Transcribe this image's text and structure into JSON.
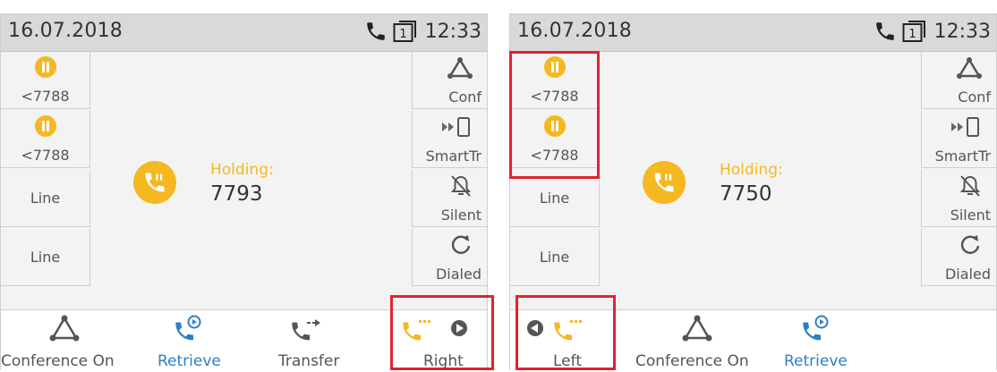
{
  "colors": {
    "accent": "#f5b820",
    "blue": "#2f7fc4",
    "highlight": "#e3222b"
  },
  "left_screen": {
    "date": "16.07.2018",
    "time": "12:33",
    "status_icons": [
      "phone-icon",
      "line-1-icon"
    ],
    "line_badge": "1",
    "line_keys": [
      {
        "label": "<7788",
        "icon": "hold-icon"
      },
      {
        "label": "<7788",
        "icon": "hold-icon"
      },
      {
        "label": "Line"
      },
      {
        "label": "Line"
      }
    ],
    "softkeys": [
      {
        "label": "Conf",
        "icon": "conference-icon"
      },
      {
        "label": "SmartTr",
        "icon": "smart-transfer-icon"
      },
      {
        "label": "Silent",
        "icon": "silent-icon"
      },
      {
        "label": "Dialed",
        "icon": "redial-icon"
      }
    ],
    "call": {
      "status": "Holding:",
      "number": "7793"
    },
    "bottom_keys": [
      {
        "label": "Conference On",
        "icon": "conference-icon"
      },
      {
        "label": "Retrieve",
        "icon": "retrieve-icon"
      },
      {
        "label": "Transfer",
        "icon": "transfer-icon"
      },
      {
        "label": "Right",
        "icon": "swap-right-icon"
      }
    ]
  },
  "right_screen": {
    "date": "16.07.2018",
    "time": "12:33",
    "status_icons": [
      "phone-icon",
      "line-1-icon"
    ],
    "line_badge": "1",
    "line_keys": [
      {
        "label": "<7788",
        "icon": "hold-icon"
      },
      {
        "label": "<7788",
        "icon": "hold-icon"
      },
      {
        "label": "Line"
      },
      {
        "label": "Line"
      }
    ],
    "softkeys": [
      {
        "label": "Conf",
        "icon": "conference-icon"
      },
      {
        "label": "SmartTr",
        "icon": "smart-transfer-icon"
      },
      {
        "label": "Silent",
        "icon": "silent-icon"
      },
      {
        "label": "Dialed",
        "icon": "redial-icon"
      }
    ],
    "call": {
      "status": "Holding:",
      "number": "7750"
    },
    "bottom_keys": [
      {
        "label": "Left",
        "icon": "swap-left-icon"
      },
      {
        "label": "Conference On",
        "icon": "conference-icon"
      },
      {
        "label": "Retrieve",
        "icon": "retrieve-icon"
      }
    ]
  }
}
